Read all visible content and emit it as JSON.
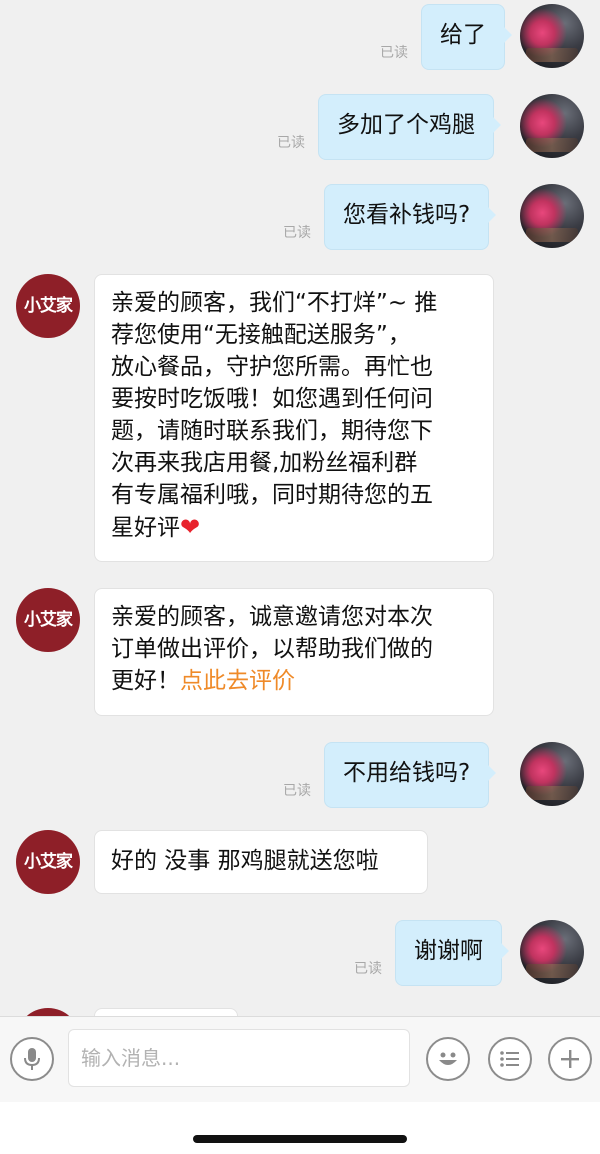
{
  "chat": {
    "read_label": "已读",
    "messages": [
      {
        "direction": "out",
        "text": "给了",
        "status": "已读"
      },
      {
        "direction": "out",
        "text": "多加了个鸡腿",
        "status": "已读"
      },
      {
        "direction": "out",
        "text": "您看补钱吗?",
        "status": "已读"
      },
      {
        "direction": "in",
        "lines": [
          "亲爱的顾客，我们“不打烊”~ 推",
          "荐您使用“无接触配送服务”，",
          "放心餐品，守护您所需。再忙也",
          "要按时吃饭哦！如您遇到任何问",
          "题，请随时联系我们，期待您下",
          "次再来我店用餐,加粉丝福利群",
          "有专属福利哦，同时期待您的五",
          "星好评"
        ],
        "emoji": "heart"
      },
      {
        "direction": "in",
        "lines": [
          "亲爱的顾客，诚意邀请您对本次",
          "订单做出评价，以帮助我们做的"
        ],
        "last_line_prefix": "更好！",
        "link_text": "点此去评价"
      },
      {
        "direction": "out",
        "text": "不用给钱吗?",
        "status": "已读"
      },
      {
        "direction": "in",
        "text": "好的 没事 那鸡腿就送您啦"
      },
      {
        "direction": "out",
        "text": "谢谢啊",
        "status": "已读"
      }
    ]
  },
  "shop_avatar": {
    "logo_text": "小艾家"
  },
  "input_bar": {
    "placeholder": "输入消息..."
  },
  "icons": {
    "voice": "microphone-icon",
    "emoji": "smiley-icon",
    "more_menu": "list-menu-icon",
    "add": "plus-icon"
  },
  "colors": {
    "outgoing_bubble": "#d3eefc",
    "incoming_bubble": "#ffffff",
    "link": "#ef8a28",
    "shop_brand": "#8e1f28",
    "read_status": "#a8a8a8"
  }
}
